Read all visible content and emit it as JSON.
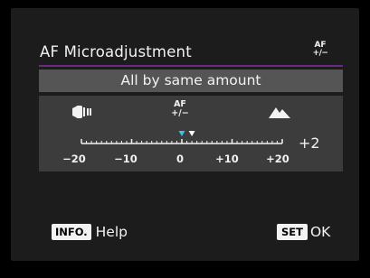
{
  "header": {
    "title": "AF Microadjustment",
    "af_icon_top": "AF",
    "af_icon_bottom": "+/−"
  },
  "mode": {
    "label": "All by same amount"
  },
  "scale": {
    "icons": {
      "left": "lens-wide-icon",
      "center_top": "AF",
      "center_bottom": "+/−",
      "right": "mountain-icon"
    },
    "min": -20,
    "max": 20,
    "tick_labels": [
      "−20",
      "−10",
      "0",
      "+10",
      "+20"
    ],
    "current_value": 2,
    "current_value_label": "+2",
    "previous_value": 0,
    "colors": {
      "current_marker": "#ffffff",
      "previous_marker": "#35c6e8"
    }
  },
  "footer": {
    "info_key": "INFO.",
    "info_label": "Help",
    "set_key": "SET",
    "set_label": "OK"
  },
  "colors": {
    "accent_rule": "#6b2a80",
    "mode_row": "#555555",
    "adjust_box": "#3c3c3c",
    "panel": "#1c1c1c"
  }
}
